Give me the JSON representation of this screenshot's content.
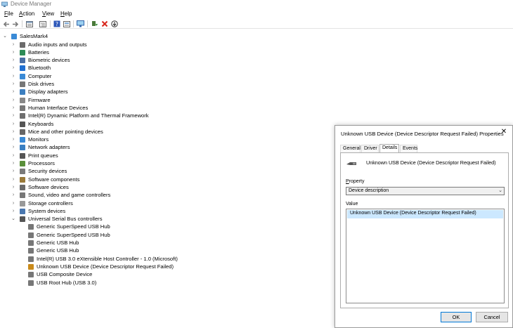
{
  "window": {
    "title": "Device Manager",
    "icon": "device-manager-icon"
  },
  "menu": [
    {
      "label": "File",
      "accel": "F",
      "rest": "ile"
    },
    {
      "label": "Action",
      "accel": "A",
      "rest": "ction"
    },
    {
      "label": "View",
      "accel": "V",
      "rest": "iew"
    },
    {
      "label": "Help",
      "accel": "H",
      "rest": "elp"
    }
  ],
  "toolbar": [
    "back-arrow-icon",
    "forward-arrow-icon",
    "properties-icon",
    "tree-icon",
    "help-icon",
    "view-icon",
    "monitor-icon",
    "update-driver-icon",
    "uninstall-x-icon",
    "download-icon"
  ],
  "tree": {
    "root": "SalesMark4",
    "categories": [
      "Audio inputs and outputs",
      "Batteries",
      "Biometric devices",
      "Bluetooth",
      "Computer",
      "Disk drives",
      "Display adapters",
      "Firmware",
      "Human Interface Devices",
      "Intel(R) Dynamic Platform and Thermal Framework",
      "Keyboards",
      "Mice and other pointing devices",
      "Monitors",
      "Network adapters",
      "Print queues",
      "Processors",
      "Security devices",
      "Software components",
      "Software devices",
      "Sound, video and game controllers",
      "Storage controllers",
      "System devices",
      "Universal Serial Bus controllers"
    ],
    "usb_children": [
      "Generic SuperSpeed USB Hub",
      "Generic SuperSpeed USB Hub",
      "Generic USB Hub",
      "Generic USB Hub",
      "Intel(R) USB 3.0 eXtensible Host Controller - 1.0 (Microsoft)",
      "Unknown USB Device (Device Descriptor Request Failed)",
      "USB Composite Device",
      "USB Root Hub (USB 3.0)"
    ]
  },
  "dialog": {
    "title": "Unknown USB Device (Device Descriptor Request Failed) Properties",
    "close": "✕",
    "tabs": [
      "General",
      "Driver",
      "Details",
      "Events"
    ],
    "active_tab": "Details",
    "device_name": "Unknown USB Device (Device Descriptor Request Failed)",
    "property_label": "Property",
    "property_value": "Device description",
    "value_label": "Value",
    "value_item": "Unknown USB Device (Device Descriptor Request Failed)",
    "ok": "OK",
    "cancel": "Cancel"
  }
}
